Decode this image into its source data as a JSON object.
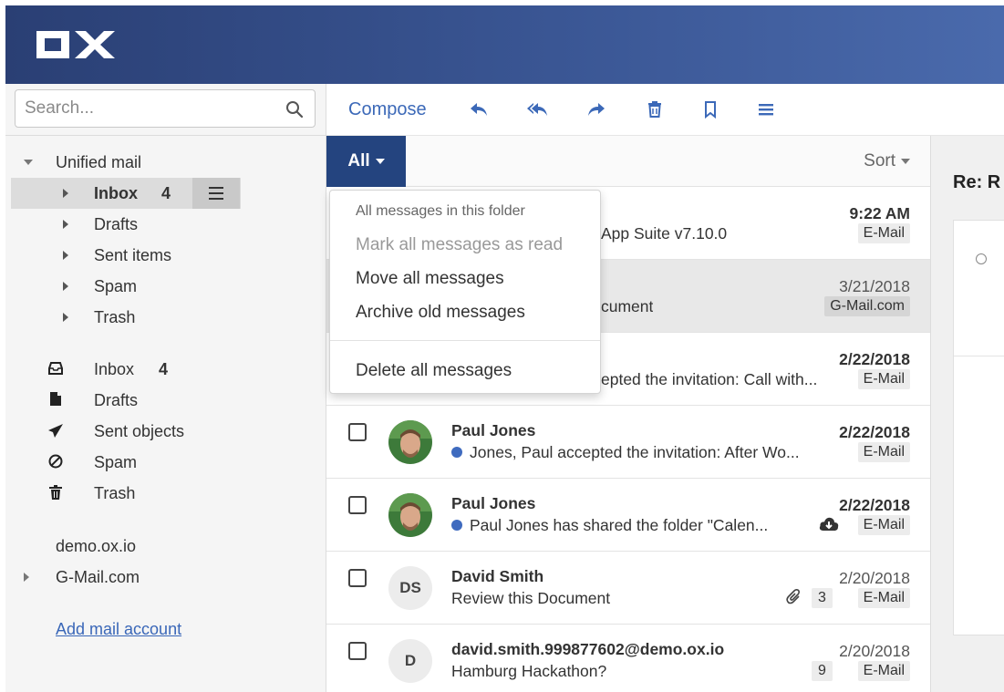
{
  "app": {
    "logo_text": "OX",
    "brand_color": "#2a3f74"
  },
  "search": {
    "placeholder": "Search..."
  },
  "sidebar": {
    "unified": {
      "label": "Unified mail",
      "folders": [
        {
          "label": "Inbox",
          "count": "4"
        },
        {
          "label": "Drafts"
        },
        {
          "label": "Sent items"
        },
        {
          "label": "Spam"
        },
        {
          "label": "Trash"
        }
      ]
    },
    "account_folders": [
      {
        "label": "Inbox",
        "count": "4",
        "icon": "inbox-icon"
      },
      {
        "label": "Drafts",
        "icon": "draft-file-icon"
      },
      {
        "label": "Sent objects",
        "icon": "paper-plane-icon"
      },
      {
        "label": "Spam",
        "icon": "ban-icon"
      },
      {
        "label": "Trash",
        "icon": "trash-icon"
      }
    ],
    "account_name": "demo.ox.io",
    "gmail_account": "G-Mail.com",
    "add_account": "Add mail account"
  },
  "toolbar": {
    "compose": "Compose",
    "icons": [
      "reply-icon",
      "reply-all-icon",
      "forward-icon",
      "delete-icon",
      "bookmark-icon",
      "more-menu-icon"
    ]
  },
  "list_header": {
    "filter": "All",
    "sort": "Sort"
  },
  "dropdown": {
    "header": "All messages in this folder",
    "items": [
      {
        "label": "Mark all messages as read",
        "disabled": true
      },
      {
        "label": "Move all messages"
      },
      {
        "label": "Archive old messages"
      },
      {
        "label": "Delete all messages"
      }
    ]
  },
  "messages": [
    {
      "from": "",
      "subject": "App Suite v7.10.0",
      "date": "9:22 AM",
      "badge": "E-Mail"
    },
    {
      "from": "",
      "subject": "cument",
      "date": "3/21/2018",
      "badge": "G-Mail.com"
    },
    {
      "from": "",
      "subject": "epted the invitation: Call with...",
      "date": "2/22/2018",
      "badge": "E-Mail"
    },
    {
      "from": "Paul Jones",
      "subject": "Jones, Paul accepted the invitation: After Wo...",
      "date": "2/22/2018",
      "badge": "E-Mail"
    },
    {
      "from": "Paul Jones",
      "subject": "Paul Jones has shared the folder \"Calen...",
      "date": "2/22/2018",
      "badge": "E-Mail"
    },
    {
      "from": "David Smith",
      "subject": "Review this Document",
      "date": "2/20/2018",
      "badge": "E-Mail",
      "initials": "DS",
      "thread_count": "3"
    },
    {
      "from": "david.smith.999877602@demo.ox.io",
      "subject": "Hamburg Hackathon?",
      "date": "2/20/2018",
      "badge": "E-Mail",
      "initials": "D",
      "thread_count": "9"
    }
  ],
  "detail": {
    "title": "Re: R"
  }
}
